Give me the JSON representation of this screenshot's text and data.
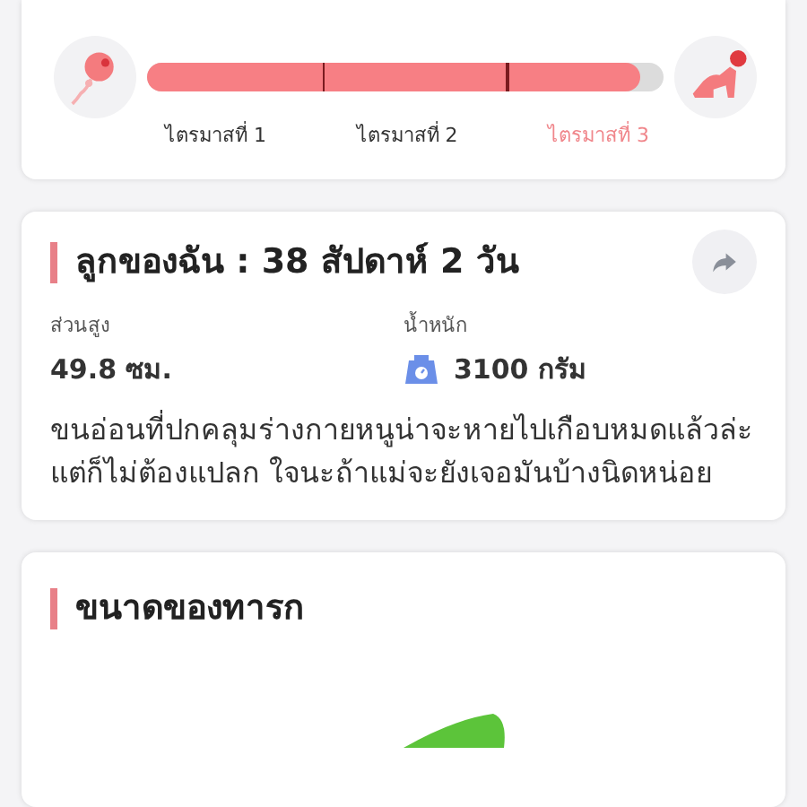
{
  "progress": {
    "level": 0.955,
    "trimesters": [
      {
        "label": "ไตรมาสที่ 1",
        "selected": false
      },
      {
        "label": "ไตรมาสที่ 2",
        "selected": false
      },
      {
        "label": "ไตรมาสที่ 3",
        "selected": true
      }
    ]
  },
  "baby": {
    "title": "ลูกของฉัน : 38 สัปดาห์ 2  วัน",
    "height_label": "ส่วนสูง",
    "height_value": "49.8 ซม.",
    "weight_label": "น้ำหนัก",
    "weight_value": "3100 กรัม",
    "description": "ขนอ่อนที่ปกคลุมร่างกายหนูน่าจะหายไปเกือบหมดแล้วล่ะ แต่ก็ไม่ต้องแปลก ใจนะถ้าแม่จะยังเจอมันบ้างนิดหน่อย"
  },
  "size": {
    "title": "ขนาดของทารก"
  }
}
